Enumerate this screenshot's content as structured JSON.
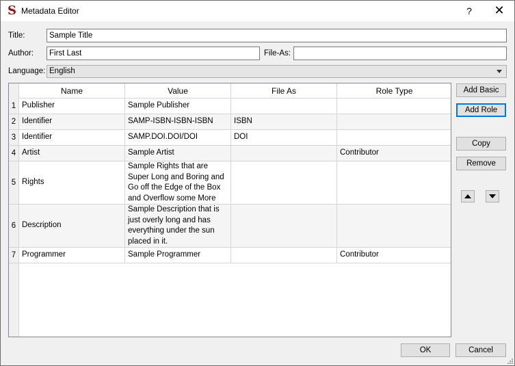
{
  "window": {
    "title": "Metadata Editor",
    "app_icon_glyph": "S",
    "help_glyph": "?",
    "close_glyph": "✕"
  },
  "form": {
    "title_label": "Title:",
    "title_value": "Sample Title",
    "author_label": "Author:",
    "author_value": "First Last",
    "file_as_label": "File-As:",
    "file_as_value": "",
    "language_label": "Language:",
    "language_value": "English"
  },
  "table": {
    "columns": [
      "Name",
      "Value",
      "File As",
      "Role Type"
    ],
    "rows": [
      {
        "num": "1",
        "name": "Publisher",
        "value": "Sample Publisher",
        "file_as": "",
        "role": ""
      },
      {
        "num": "2",
        "name": "Identifier",
        "value": "SAMP-ISBN-ISBN-ISBN",
        "file_as": "ISBN",
        "role": ""
      },
      {
        "num": "3",
        "name": "Identifier",
        "value": "SAMP.DOI.DOI/DOI",
        "file_as": "DOI",
        "role": ""
      },
      {
        "num": "4",
        "name": "Artist",
        "value": "Sample Artist",
        "file_as": "",
        "role": "Contributor"
      },
      {
        "num": "5",
        "name": "Rights",
        "value": "Sample Rights that are Super Long and Boring and Go off the Edge of the Box and Overflow some More",
        "file_as": "",
        "role": ""
      },
      {
        "num": "6",
        "name": "Description",
        "value": "Sample Description that is just overly long and has everything under the sun placed in it.",
        "file_as": "",
        "role": ""
      },
      {
        "num": "7",
        "name": "Programmer",
        "value": "Sample Programmer",
        "file_as": "",
        "role": "Contributor"
      }
    ]
  },
  "buttons": {
    "add_basic": "Add Basic",
    "add_role": "Add Role",
    "copy": "Copy",
    "remove": "Remove",
    "move_up_icon": "arrow-up-icon",
    "move_down_icon": "arrow-down-icon",
    "ok": "OK",
    "cancel": "Cancel"
  },
  "colors": {
    "focus_border": "#0078d7",
    "app_icon": "#8b1a1a"
  }
}
